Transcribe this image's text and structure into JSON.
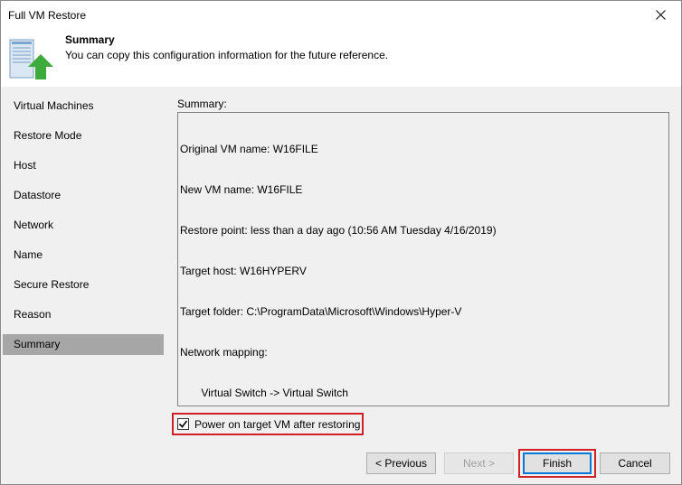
{
  "window": {
    "title": "Full VM Restore"
  },
  "header": {
    "title": "Summary",
    "subtitle": "You can copy this configuration information for the future reference.",
    "icon": "restore-vm-icon"
  },
  "nav": {
    "items": [
      {
        "label": "Virtual Machines"
      },
      {
        "label": "Restore Mode"
      },
      {
        "label": "Host"
      },
      {
        "label": "Datastore"
      },
      {
        "label": "Network"
      },
      {
        "label": "Name"
      },
      {
        "label": "Secure Restore"
      },
      {
        "label": "Reason"
      },
      {
        "label": "Summary",
        "active": true
      }
    ]
  },
  "summary": {
    "label": "Summary:",
    "lines": [
      "Original VM name: W16FILE",
      "New VM name: W16FILE",
      "Restore point: less than a day ago (10:56 AM Tuesday 4/16/2019)",
      "Target host: W16HYPERV",
      "Target folder: C:\\ProgramData\\Microsoft\\Windows\\Hyper-V",
      "Network mapping:",
      "       Virtual Switch -> Virtual Switch"
    ]
  },
  "options": {
    "power_on_label": "Power on target VM after restoring",
    "power_on_checked": true
  },
  "footer": {
    "previous_label": "< Previous",
    "next_label": "Next >",
    "finish_label": "Finish",
    "cancel_label": "Cancel"
  },
  "colors": {
    "highlight": "#d11f26",
    "nav_active": "#a6a6a6",
    "accent": "#0078d7",
    "arrow_green": "#3cab3b"
  }
}
